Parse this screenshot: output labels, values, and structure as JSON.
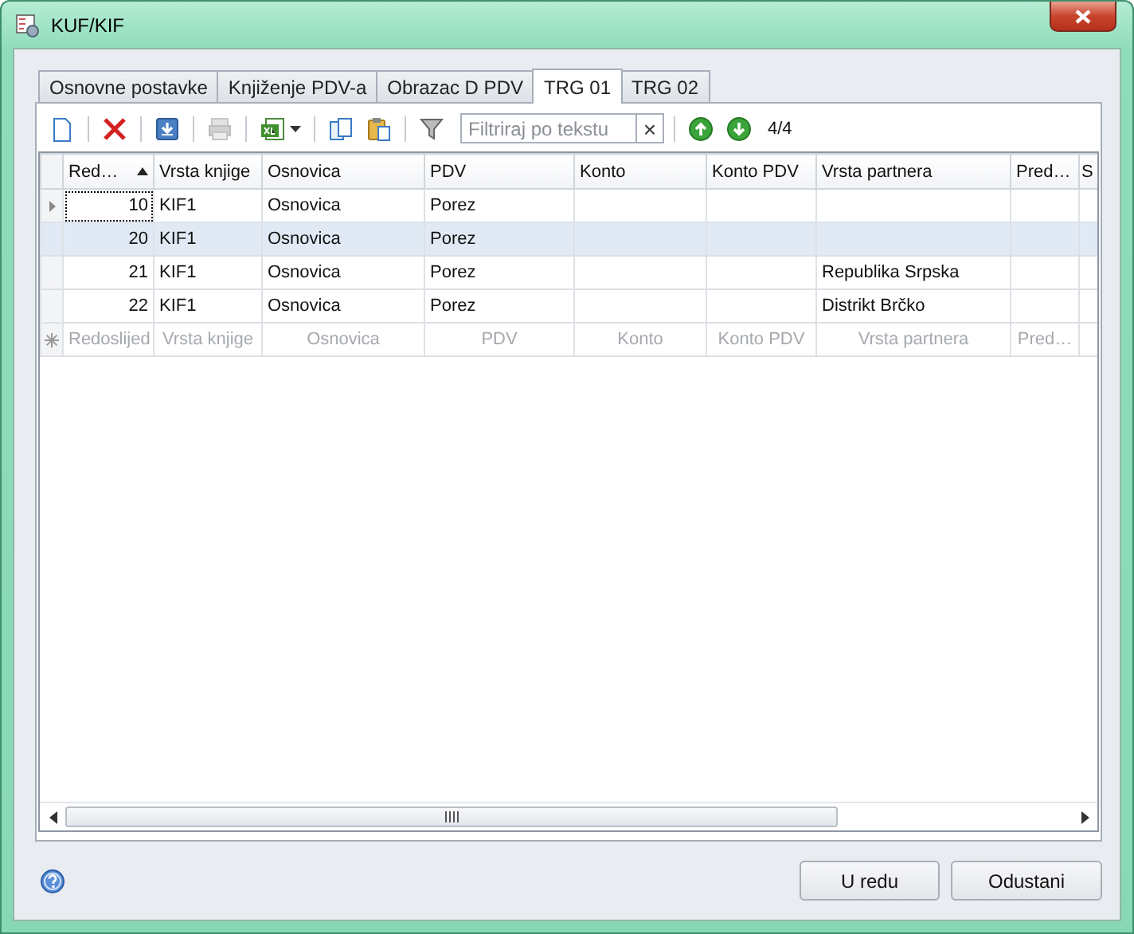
{
  "window": {
    "title": "KUF/KIF"
  },
  "tabs": [
    {
      "label": "Osnovne postavke",
      "selected": false
    },
    {
      "label": "Knjiženje PDV-a",
      "selected": false
    },
    {
      "label": "Obrazac D PDV",
      "selected": false
    },
    {
      "label": "TRG 01",
      "selected": true
    },
    {
      "label": "TRG 02",
      "selected": false
    }
  ],
  "toolbar": {
    "items": [
      {
        "kind": "new",
        "disabled": false
      },
      {
        "kind": "separator"
      },
      {
        "kind": "delete",
        "disabled": false
      },
      {
        "kind": "separator"
      },
      {
        "kind": "save",
        "disabled": false
      },
      {
        "kind": "separator"
      },
      {
        "kind": "print",
        "disabled": true
      },
      {
        "kind": "separator"
      },
      {
        "kind": "excel",
        "disabled": false
      },
      {
        "kind": "separator"
      },
      {
        "kind": "copy",
        "disabled": false
      },
      {
        "kind": "paste",
        "disabled": false
      },
      {
        "kind": "separator"
      },
      {
        "kind": "filter",
        "disabled": false
      }
    ],
    "filter": {
      "placeholder": "Filtriraj po tekstu",
      "clear": "×"
    },
    "nav": [
      {
        "kind": "up",
        "disabled": false
      },
      {
        "kind": "down",
        "disabled": false
      }
    ],
    "count": "4/4"
  },
  "grid": {
    "columns": [
      {
        "label": "Red…",
        "sorted": true
      },
      {
        "label": "Vrsta knjige",
        "sorted": false
      },
      {
        "label": "Osnovica",
        "sorted": false
      },
      {
        "label": "PDV",
        "sorted": false
      },
      {
        "label": "Konto",
        "sorted": false
      },
      {
        "label": "Konto PDV",
        "sorted": false
      },
      {
        "label": "Vrsta partnera",
        "sorted": false
      },
      {
        "label": "Pred…",
        "sorted": false
      },
      {
        "label": "S",
        "sorted": false
      }
    ],
    "rows": [
      {
        "cells": [
          "10",
          "KIF1",
          "Osnovica",
          "Porez",
          "",
          "",
          "",
          "",
          ""
        ],
        "selected": false,
        "current": true
      },
      {
        "cells": [
          "20",
          "KIF1",
          "Osnovica",
          "Porez",
          "",
          "",
          "",
          "",
          ""
        ],
        "selected": true,
        "current": false
      },
      {
        "cells": [
          "21",
          "KIF1",
          "Osnovica",
          "Porez",
          "",
          "",
          "Republika Srpska",
          "",
          ""
        ],
        "selected": false,
        "current": false
      },
      {
        "cells": [
          "22",
          "KIF1",
          "Osnovica",
          "Porez",
          "",
          "",
          "Distrikt Brčko",
          "",
          ""
        ],
        "selected": false,
        "current": false
      }
    ],
    "new_row": {
      "placeholders": [
        "Redoslijed",
        "Vrsta knjige",
        "Osnovica",
        "PDV",
        "Konto",
        "Konto PDV",
        "Vrsta partnera",
        "Pred…"
      ]
    }
  },
  "footer": {
    "buttons": [
      "U redu",
      "Odustani"
    ]
  }
}
